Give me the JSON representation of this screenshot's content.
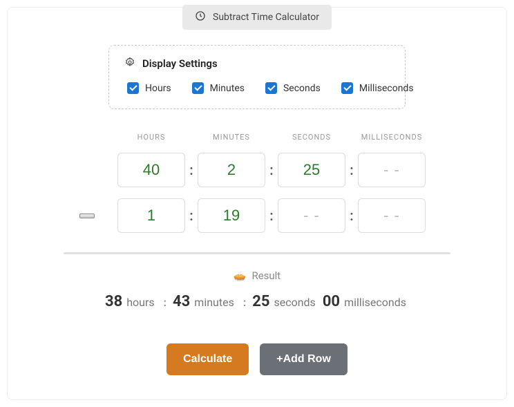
{
  "title": "Subtract Time Calculator",
  "settings": {
    "heading": "Display Settings",
    "options": {
      "hours": {
        "label": "Hours",
        "checked": true
      },
      "minutes": {
        "label": "Minutes",
        "checked": true
      },
      "seconds": {
        "label": "Seconds",
        "checked": true
      },
      "milliseconds": {
        "label": "Milliseconds",
        "checked": true
      }
    }
  },
  "columns": {
    "hours": "HOURS",
    "minutes": "MINUTES",
    "seconds": "SECONDS",
    "milliseconds": "MILLISECONDS"
  },
  "placeholder": "- -",
  "rows": [
    {
      "hours": "40",
      "minutes": "2",
      "seconds": "25",
      "milliseconds": ""
    },
    {
      "hours": "1",
      "minutes": "19",
      "seconds": "",
      "milliseconds": ""
    }
  ],
  "result": {
    "heading": "Result",
    "hours": {
      "value": "38",
      "unit": "hours"
    },
    "minutes": {
      "value": "43",
      "unit": "minutes"
    },
    "seconds": {
      "value": "25",
      "unit": "seconds"
    },
    "ms": {
      "value": "00",
      "unit": "milliseconds"
    }
  },
  "buttons": {
    "calculate": "Calculate",
    "addRow": "+Add Row"
  }
}
